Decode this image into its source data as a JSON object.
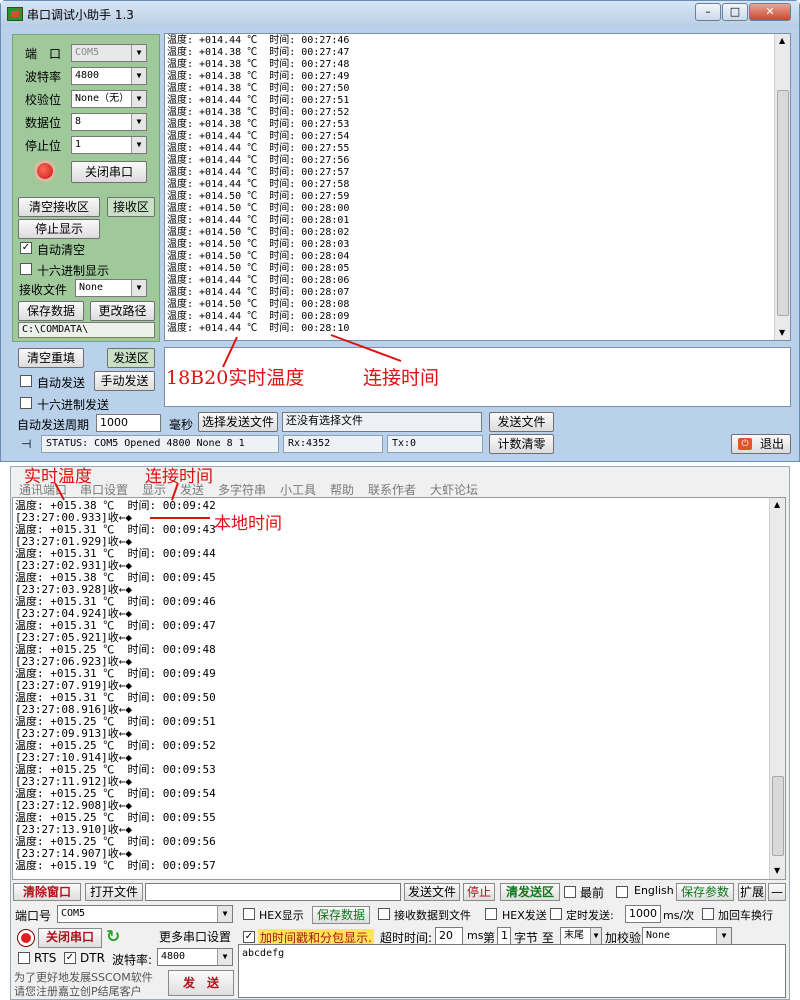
{
  "top_window": {
    "title": "串口调试小助手 1.3",
    "win_buttons": {
      "minimize": "–",
      "maximize": "□",
      "close": "✕"
    },
    "port_label": "端　口",
    "port_value": "COM5",
    "baud_label": "波特率",
    "baud_value": "4800",
    "parity_label": "校验位",
    "parity_value": "None（无）",
    "databits_label": "数据位",
    "databits_value": "8",
    "stopbits_label": "停止位",
    "stopbits_value": "1",
    "close_port_button": "关闭串口",
    "clear_recv_button": "清空接收区",
    "recv_area_label": "接收区",
    "stop_display_button": "停止显示",
    "auto_clear_label": "自动清空",
    "hex_display_label": "十六进制显示",
    "recv_file_label": "接收文件",
    "recv_file_value": "None",
    "save_data_button": "保存数据",
    "change_path_button": "更改路径",
    "path_value": "C:\\COMDATA\\",
    "clear_resend_button": "清空重填",
    "send_area_label": "发送区",
    "auto_send_label": "自动发送",
    "manual_send_button": "手动发送",
    "hex_send_label": "十六进制发送",
    "auto_period_label": "自动发送周期",
    "period_value": "1000",
    "ms_label": "毫秒",
    "select_file_button": "选择发送文件",
    "no_file_text": "还没有选择文件",
    "send_file_button": "发送文件",
    "status_text": "STATUS: COM5 Opened 4800 None  8 1",
    "rx_text": "Rx:4352",
    "tx_text": "Tx:0",
    "count_clear_button": "计数清零",
    "exit_button": "退出",
    "annotation_temp": "18B20实时温度",
    "annotation_time": "连接时间",
    "recv_lines": [
      "温度: +014.44 ℃  时间: 00:27:46",
      "温度: +014.38 ℃  时间: 00:27:47",
      "温度: +014.38 ℃  时间: 00:27:48",
      "温度: +014.38 ℃  时间: 00:27:49",
      "温度: +014.38 ℃  时间: 00:27:50",
      "温度: +014.44 ℃  时间: 00:27:51",
      "温度: +014.38 ℃  时间: 00:27:52",
      "温度: +014.38 ℃  时间: 00:27:53",
      "温度: +014.44 ℃  时间: 00:27:54",
      "温度: +014.44 ℃  时间: 00:27:55",
      "温度: +014.44 ℃  时间: 00:27:56",
      "温度: +014.44 ℃  时间: 00:27:57",
      "温度: +014.44 ℃  时间: 00:27:58",
      "温度: +014.50 ℃  时间: 00:27:59",
      "温度: +014.50 ℃  时间: 00:28:00",
      "温度: +014.44 ℃  时间: 00:28:01",
      "温度: +014.50 ℃  时间: 00:28:02",
      "温度: +014.50 ℃  时间: 00:28:03",
      "温度: +014.50 ℃  时间: 00:28:04",
      "温度: +014.50 ℃  时间: 00:28:05",
      "温度: +014.44 ℃  时间: 00:28:06",
      "温度: +014.44 ℃  时间: 00:28:07",
      "温度: +014.50 ℃  时间: 00:28:08",
      "温度: +014.44 ℃  时间: 00:28:09",
      "温度: +014.44 ℃  时间: 00:28:10"
    ]
  },
  "bottom_window": {
    "menu": [
      "通讯端口",
      "串口设置",
      "显示",
      "发送",
      "多字符串",
      "小工具",
      "帮助",
      "联系作者",
      "大虾论坛"
    ],
    "annotation_temp": "实时温度",
    "annotation_time": "连接时间",
    "annotation_local": "本地时间",
    "recv_lines": [
      "温度: +015.38 ℃  时间: 00:09:42",
      "[23:27:00.933]收←◆",
      "温度: +015.31 ℃  时间: 00:09:43",
      "[23:27:01.929]收←◆",
      "温度: +015.31 ℃  时间: 00:09:44",
      "[23:27:02.931]收←◆",
      "温度: +015.38 ℃  时间: 00:09:45",
      "[23:27:03.928]收←◆",
      "温度: +015.31 ℃  时间: 00:09:46",
      "[23:27:04.924]收←◆",
      "温度: +015.31 ℃  时间: 00:09:47",
      "[23:27:05.921]收←◆",
      "温度: +015.25 ℃  时间: 00:09:48",
      "[23:27:06.923]收←◆",
      "温度: +015.31 ℃  时间: 00:09:49",
      "[23:27:07.919]收←◆",
      "温度: +015.31 ℃  时间: 00:09:50",
      "[23:27:08.916]收←◆",
      "温度: +015.25 ℃  时间: 00:09:51",
      "[23:27:09.913]收←◆",
      "温度: +015.25 ℃  时间: 00:09:52",
      "[23:27:10.914]收←◆",
      "温度: +015.25 ℃  时间: 00:09:53",
      "[23:27:11.912]收←◆",
      "温度: +015.25 ℃  时间: 00:09:54",
      "[23:27:12.908]收←◆",
      "温度: +015.25 ℃  时间: 00:09:55",
      "[23:27:13.910]收←◆",
      "温度: +015.25 ℃  时间: 00:09:56",
      "[23:27:14.907]收←◆",
      "温度: +015.19 ℃  时间: 00:09:57"
    ],
    "clear_window_button": "清除窗口",
    "open_file_button": "打开文件",
    "send_file_button": "发送文件",
    "stop_button": "停止",
    "clear_send_button": "清发送区",
    "topmost_label": "最前",
    "english_label": "English",
    "save_params_button": "保存参数",
    "expand_button": "扩展",
    "collapse_button": "—",
    "port_label": "端口号",
    "port_value": "COM5",
    "hex_display_label": "HEX显示",
    "save_data_button": "保存数据",
    "recv_to_file_label": "接收数据到文件",
    "hex_send_label": "HEX发送",
    "timed_send_label": "定时发送:",
    "timed_value": "1000",
    "ms_per_label": "ms/次",
    "add_crlf_label": "加回车换行",
    "close_port_button": "关闭串口",
    "more_ports_button": "更多串口设置",
    "timestamp_label": "加时间戳和分包显示.",
    "timeout_label": "超时时间:",
    "timeout_value": "20",
    "ms_label": "ms",
    "byte_label": "第",
    "byte_value": "1",
    "byte_to_label": "字节 至",
    "tail_value": "末尾",
    "checksum_label": "加校验",
    "checksum_value": "None",
    "rts_label": "RTS",
    "dtr_label": "DTR",
    "baud_label": "波特率:",
    "baud_value": "4800",
    "send_text": "abcdefg",
    "promo_line1": "为了更好地发展SSCOM软件",
    "promo_line2": "请您注册嘉立创P结尾客户",
    "send_button": "发　送"
  }
}
